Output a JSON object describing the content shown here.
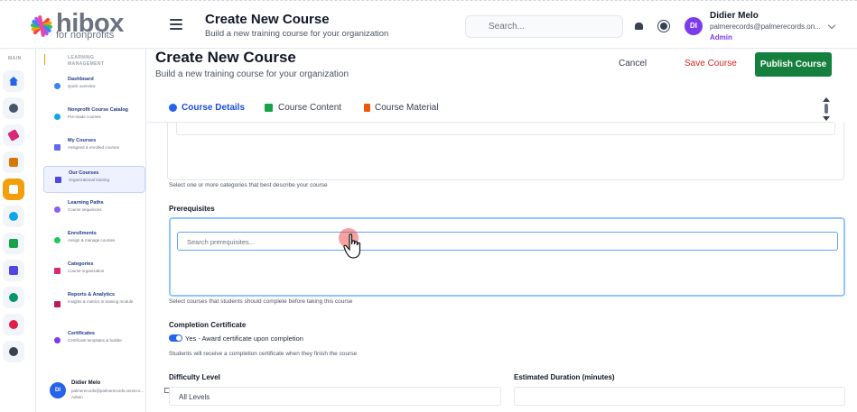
{
  "brand": {
    "name": "hibox",
    "tagline": "for nonprofits"
  },
  "header": {
    "title": "Create New Course",
    "subtitle": "Build a new training course for your organization",
    "search_placeholder": "Search...",
    "user_initials": "DI",
    "user_name": "Didier Melo",
    "user_email": "palmerecords@palmerecords.on...",
    "user_role": "Admin"
  },
  "rail": {
    "label": "MAIN"
  },
  "sidebar": {
    "section": "LEARNING MANAGEMENT",
    "items": [
      {
        "title": "Dashboard",
        "subtitle": "Quick overview"
      },
      {
        "title": "Nonprofit Course Catalog",
        "subtitle": "Pre-made courses"
      },
      {
        "title": "My Courses",
        "subtitle": "Assigned & enrolled courses"
      },
      {
        "title": "Our Courses",
        "subtitle": "Organizational training"
      },
      {
        "title": "Learning Paths",
        "subtitle": "Course sequences"
      },
      {
        "title": "Enrollments",
        "subtitle": "Assign & manage courses"
      },
      {
        "title": "Categories",
        "subtitle": "Course organization"
      },
      {
        "title": "Reports & Analytics",
        "subtitle": "Insights & metrics in training module"
      },
      {
        "title": "Certificates",
        "subtitle": "Certificate templates & builder"
      }
    ],
    "footer": {
      "initials": "DI",
      "name": "Didier Melo",
      "email": "palmerecords@palmerecords.onmicro...",
      "role": "Admin"
    }
  },
  "page": {
    "title": "Create New Course",
    "subtitle": "Build a new training course for your organization",
    "cancel_label": "Cancel",
    "save_label": "Save Course",
    "publish_label": "Publish Course"
  },
  "tabs": [
    {
      "label": "Course Details",
      "active": true
    },
    {
      "label": "Course Content",
      "active": false
    },
    {
      "label": "Course Material",
      "active": false
    }
  ],
  "form": {
    "categories_help": "Select one or more categories that best describe your course",
    "prerequisites_label": "Prerequisites",
    "prerequisites_placeholder": "Search prerequisites...",
    "prerequisites_help": "Select courses that students should complete before taking this course",
    "certificate_label": "Completion Certificate",
    "certificate_toggle_text": "Yes - Award certificate upon completion",
    "certificate_toggle_on": true,
    "certificate_help": "Students will receive a completion certificate when they finish the course",
    "difficulty_label": "Difficulty Level",
    "difficulty_value": "All Levels",
    "duration_label": "Estimated Duration (minutes)",
    "duration_value": ""
  },
  "colors": {
    "accent": "#1d4ed8",
    "publish": "#15803d",
    "save": "#dc2626",
    "rail_active": "#f59e0b"
  }
}
